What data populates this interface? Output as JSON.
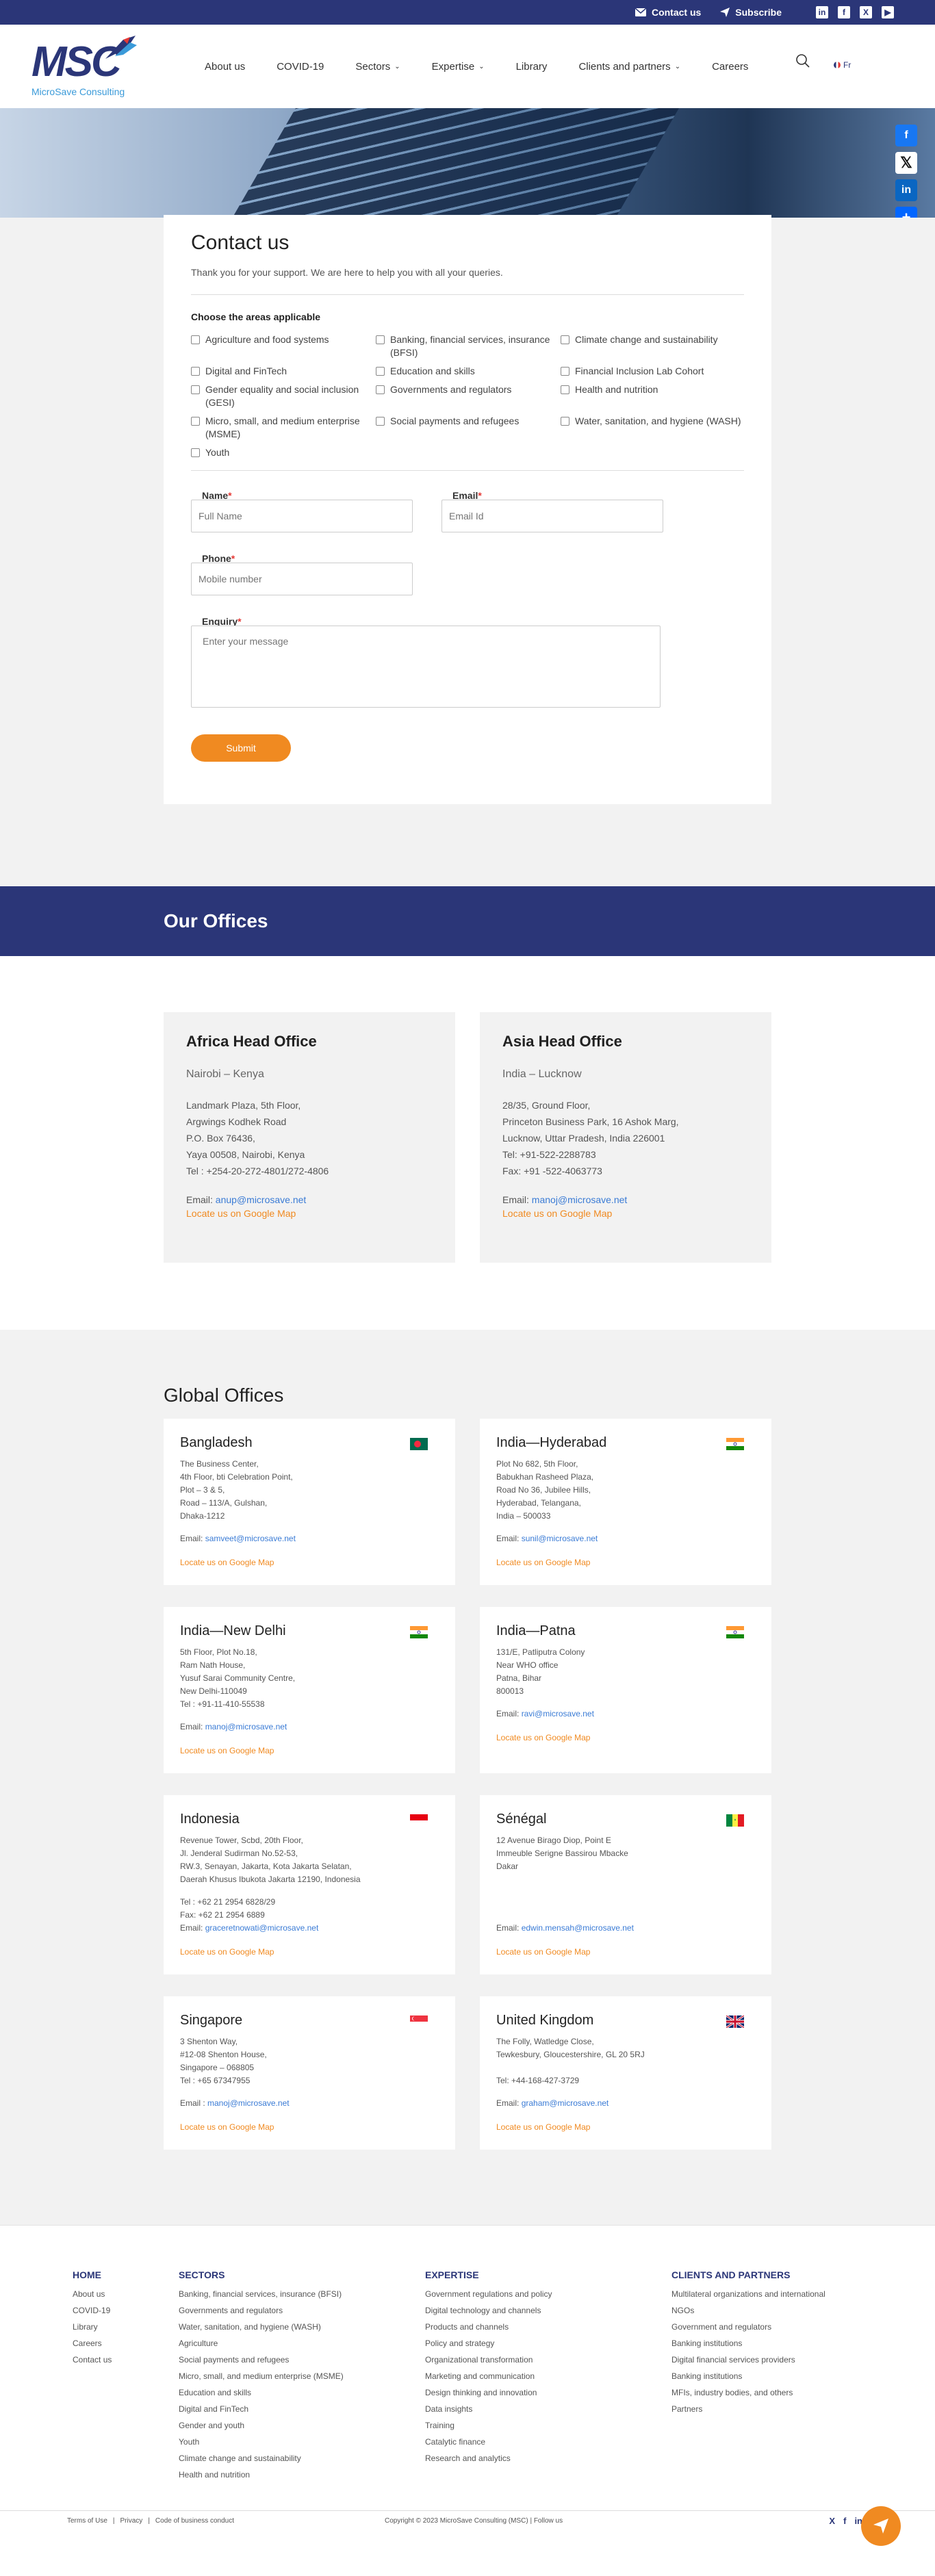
{
  "topbar": {
    "contact": "Contact us",
    "subscribe": "Subscribe"
  },
  "header": {
    "logo_text": "MSC",
    "logo_tagline": "MicroSave Consulting",
    "nav": [
      "About us",
      "COVID-19",
      "Sectors",
      "Expertise",
      "Library",
      "Clients and partners",
      "Careers"
    ],
    "nav_dropdowns": [
      false,
      false,
      true,
      true,
      false,
      true,
      false
    ],
    "lang": "Fr"
  },
  "contact": {
    "title": "Contact us",
    "subtitle": "Thank you for your support. We are here to help you with all your queries.",
    "areas_title": "Choose the areas applicable",
    "areas": [
      "Agriculture and food systems",
      "Banking, financial services, insurance (BFSI)",
      "Climate change and sustainability",
      "Digital and FinTech",
      "Education and skills",
      "Financial Inclusion Lab Cohort",
      "Gender equality and social inclusion (GESI)",
      "Governments and regulators",
      "Health and nutrition",
      "Micro, small, and medium enterprise (MSME)",
      "Social payments and refugees",
      "Water, sanitation, and hygiene (WASH)",
      "Youth"
    ],
    "name_label": "Name",
    "name_placeholder": "Full Name",
    "email_label": "Email",
    "email_placeholder": "Email Id",
    "phone_label": "Phone",
    "phone_placeholder": "Mobile number",
    "enquiry_label": "Enquiry",
    "enquiry_placeholder": "Enter your message",
    "submit": "Submit"
  },
  "offices_banner": "Our Offices",
  "head_offices": [
    {
      "title": "Africa Head Office",
      "city": "Nairobi – Kenya",
      "address": [
        "Landmark Plaza, 5th Floor,",
        "Argwings Kodhek Road",
        "P.O. Box 76436,",
        "Yaya 00508, Nairobi, Kenya",
        "Tel : +254-20-272-4801/272-4806"
      ],
      "email_label": "Email:",
      "email": "anup@microsave.net",
      "map": "Locate us on Google Map"
    },
    {
      "title": "Asia Head Office",
      "city": "India – Lucknow",
      "address": [
        "28/35, Ground Floor,",
        "Princeton Business Park, 16 Ashok Marg,",
        "Lucknow, Uttar Pradesh, India 226001",
        "Tel: +91-522-2288783",
        "Fax: +91 -522-4063773"
      ],
      "email_label": "Email:",
      "email": "manoj@microsave.net",
      "map": "Locate us on Google Map"
    }
  ],
  "global_title": "Global Offices",
  "global_offices": [
    {
      "name": "Bangladesh",
      "flag": "bd",
      "address": "The Business Center,\n4th Floor, bti Celebration Point,\nPlot – 3 & 5,\nRoad – 113/A, Gulshan,\nDhaka-1212",
      "contact": "Email: ",
      "email": "samveet@microsave.net",
      "map": "Locate us on Google Map"
    },
    {
      "name": "India—Hyderabad",
      "flag": "in",
      "address": "Plot No 682, 5th Floor,\nBabukhan Rasheed Plaza,\nRoad No 36, Jubilee Hills,\nHyderabad, Telangana,\nIndia – 500033",
      "contact": "Email: ",
      "email": "sunil@microsave.net",
      "map": "Locate us on Google Map"
    },
    {
      "name": "India—New Delhi",
      "flag": "in",
      "address": "5th Floor, Plot No.18,\nRam Nath House,\nYusuf Sarai Community Centre,\nNew Delhi-110049\nTel : +91-11-410-55538",
      "contact": "Email: ",
      "email": "manoj@microsave.net",
      "map": "Locate us on Google Map"
    },
    {
      "name": "India—Patna",
      "flag": "in",
      "address": "131/E, Patliputra Colony\nNear WHO office\nPatna, Bihar\n800013",
      "contact": "Email: ",
      "email": "ravi@microsave.net",
      "map": "Locate us on Google Map"
    },
    {
      "name": "Indonesia",
      "flag": "id",
      "address": "Revenue Tower, Scbd, 20th Floor,\nJl. Jenderal Sudirman No.52-53,\nRW.3, Senayan, Jakarta, Kota Jakarta Selatan,\nDaerah Khusus Ibukota Jakarta 12190, Indonesia",
      "contact": "Tel : +62 21 2954 6828/29\nFax: +62 21 2954 6889\nEmail: ",
      "email": "graceretnowati@microsave.net",
      "map": "Locate us on Google Map"
    },
    {
      "name": "Sénégal",
      "flag": "sn",
      "address": "12 Avenue Birago Diop, Point E\nImmeuble Serigne Bassirou Mbacke\nDakar",
      "contact": "\n\n\nEmail: ",
      "email": "edwin.mensah@microsave.net",
      "map": "Locate us on Google Map"
    },
    {
      "name": "Singapore",
      "flag": "sg",
      "address": "3 Shenton Way,\n#12-08 Shenton House,\nSingapore – 068805\nTel : +65 67347955",
      "contact": "Email : ",
      "email": "manoj@microsave.net",
      "map": "Locate us on Google Map"
    },
    {
      "name": "United Kingdom",
      "flag": "gb",
      "address": "The Folly, Watledge Close,\nTewkesbury, Gloucestershire, GL 20 5RJ\n\nTel: +44-168-427-3729",
      "contact": "Email: ",
      "email": "graham@microsave.net",
      "map": "Locate us on Google Map"
    }
  ],
  "footer": {
    "home": {
      "title": "HOME",
      "items": [
        "About us",
        "COVID-19",
        "Library",
        "Careers",
        "Contact us"
      ]
    },
    "sectors": {
      "title": "SECTORS",
      "items": [
        "Banking, financial services, insurance (BFSI)",
        "Governments and regulators",
        "Water, sanitation, and hygiene (WASH)",
        "Agriculture",
        "Social payments and refugees",
        "Micro, small, and medium enterprise (MSME)",
        "Education and skills",
        "Digital and FinTech",
        "Gender and youth",
        "Youth",
        "Climate change and sustainability",
        "Health and nutrition"
      ]
    },
    "expertise": {
      "title": "EXPERTISE",
      "items": [
        "Government regulations and policy",
        "Digital technology and channels",
        "Products and channels",
        "Policy and strategy",
        "Organizational transformation",
        "Marketing and communication",
        "Design thinking and innovation",
        "Data insights",
        "Training",
        "Catalytic finance",
        "Research and analytics"
      ]
    },
    "clients": {
      "title": "CLIENTS AND PARTNERS",
      "items": [
        "Multilateral organizations and international NGOs",
        "Government and regulators",
        "Banking institutions",
        "Digital financial services providers",
        "Banking institutions",
        "MFIs, industry bodies, and others",
        "Partners"
      ]
    },
    "bottom_links": [
      "Terms of Use",
      "|",
      "Privacy",
      "|",
      "Code of business conduct"
    ],
    "copyright": "Copyright © 2023 MicroSave Consulting (MSC) | Follow us"
  },
  "colors": {
    "navy": "#2b3678",
    "orange": "#f08a21",
    "link_blue": "#3a7bd5"
  }
}
